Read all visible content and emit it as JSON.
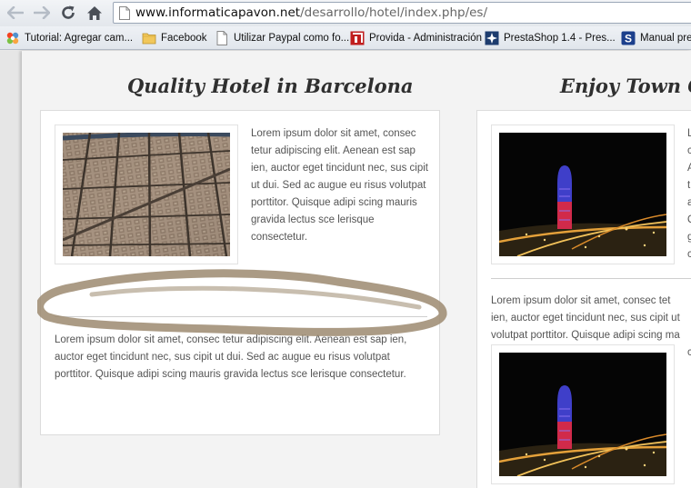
{
  "browser": {
    "url_host": "www.informaticapavon.net",
    "url_path": "/desarrollo/hotel/index.php/es/",
    "bookmarks": [
      {
        "label": "Tutorial: Agregar cam...",
        "icon": "joomla-icon"
      },
      {
        "label": "Facebook",
        "icon": "folder-icon"
      },
      {
        "label": "Utilizar Paypal como fo...",
        "icon": "page-icon"
      },
      {
        "label": "Provida - Administración",
        "icon": "provida-icon"
      },
      {
        "label": "PrestaShop 1.4 - Pres...",
        "icon": "prestashop-icon"
      },
      {
        "label": "Manual pres",
        "icon": "s-icon"
      }
    ]
  },
  "sections": [
    {
      "title": "Quality Hotel in Barcelona",
      "intro_text": "Lorem ipsum dolor sit amet, consec tetur adipiscing elit. Aenean est sap ien, auctor eget tincidunt nec, sus cipit ut dui. Sed ac augue eu risus volutpat porttitor. Quisque adipi scing mauris gravida lectus sce lerisque consectetur.",
      "body_text": "Lorem ipsum dolor sit amet, consec tetur adipiscing elit. Aenean est sap ien, auctor eget tincidunt nec, sus cipit ut dui. Sed ac augue eu risus volutpat porttitor. Quisque adipi scing mauris gravida lectus sce lerisque consectetur.",
      "image": "barcelona-aerial-photo"
    },
    {
      "title": "Enjoy Town Cen",
      "side_letters": [
        "L",
        "c",
        "A",
        "t",
        "a",
        "Q",
        "g",
        "c"
      ],
      "body_text": "Lorem ipsum dolor sit amet, consec tetur adipiscing elit. Aenean est sap ien, auctor eget tincidunt nec, sus cipit ut dui. Sed ac augue eu risus volutpat porttitor. Quisque adipi scing mauris gravida lectus sce lerisque consectetur.",
      "body_lines": [
        " Lorem ipsum dolor sit amet, consec tet",
        "ien, auctor eget tincidunt nec, sus cipit ut",
        "volutpat porttitor. Quisque adipi scing ma"
      ],
      "body_trailing_letter": "c",
      "image": "torre-agbar-night-photo"
    }
  ],
  "colors": {
    "scribble": "#9c8a70"
  }
}
